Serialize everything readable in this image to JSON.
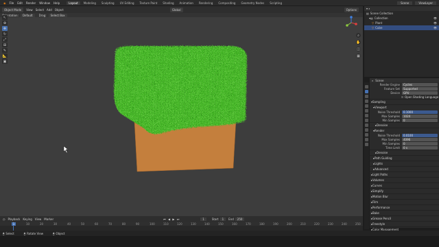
{
  "menubar": {
    "items": [
      "File",
      "Edit",
      "Render",
      "Window",
      "Help"
    ],
    "workspaces": [
      "Layout",
      "Modeling",
      "Sculpting",
      "UV Editing",
      "Texture Paint",
      "Shading",
      "Animation",
      "Rendering",
      "Compositing",
      "Geometry Nodes",
      "Scripting"
    ],
    "active_workspace": "Layout",
    "scene_label": "Scene",
    "view_layer_label": "ViewLayer"
  },
  "viewport_header": {
    "mode": "Object Mode",
    "view": "View",
    "select": "Select",
    "add": "Add",
    "object": "Object",
    "orientation": "Global",
    "options": "Options",
    "transform_orientation": "Orientation:",
    "default": "Default",
    "drag": "Drag:",
    "select_box": "Select Box"
  },
  "outliner": {
    "rows": [
      "Scene Collection",
      "Collection",
      "Plant",
      "Cube"
    ]
  },
  "properties": {
    "header": "Scene",
    "render_engine_label": "Render Engine",
    "render_engine": "Cycles",
    "feature_set_label": "Feature Set",
    "feature_set": "Supported",
    "device_label": "Device",
    "device": "GPU",
    "osl": "Open Shading Language",
    "sampling": "Sampling",
    "viewport": "Viewport",
    "noise_threshold_label": "Noise Threshold",
    "noise_threshold": "0.1000",
    "max_samples_label": "Max Samples",
    "max_samples": "1024",
    "min_samples_label": "Min Samples",
    "min_samples": "0",
    "denoise": "Denoise",
    "render": "Render",
    "r_noise_threshold": "0.0100",
    "r_max_samples": "4096",
    "r_min_samples": "0",
    "time_limit_label": "Time Limit",
    "time_limit": "0 s",
    "panels": [
      "Denoise",
      "Path Guiding",
      "Lights",
      "Advanced",
      "Light Paths",
      "Volumes",
      "Curves",
      "Simplify",
      "Motion Blur",
      "Film",
      "Performance",
      "Bake",
      "Grease Pencil",
      "Freestyle",
      "Color Management"
    ]
  },
  "timeline": {
    "menu": [
      "Playback",
      "Keying",
      "View",
      "Marker"
    ],
    "current_frame": "1",
    "start_label": "Start",
    "start": "1",
    "end_label": "End",
    "end": "250",
    "ticks": [
      "0",
      "10",
      "20",
      "30",
      "40",
      "50",
      "60",
      "70",
      "80",
      "90",
      "100",
      "110",
      "120",
      "130",
      "140",
      "150",
      "160",
      "170",
      "180",
      "190",
      "200",
      "210",
      "220",
      "230",
      "240",
      "250"
    ]
  },
  "statusbar": {
    "select": "Select",
    "rotate": "Rotate View",
    "context": "Object"
  }
}
